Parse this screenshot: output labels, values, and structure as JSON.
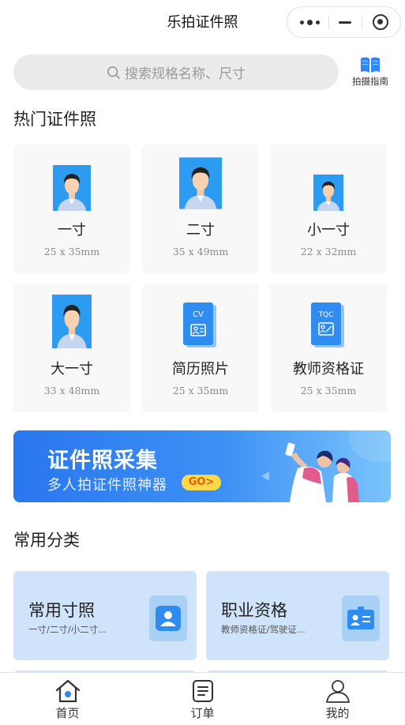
{
  "navbar": {
    "title": "乐拍证件照"
  },
  "search": {
    "placeholder": "搜索规格名称、尺寸",
    "guide_label": "拍摄指南"
  },
  "hot": {
    "title": "热门证件照",
    "cards": [
      {
        "name": "一寸",
        "size": "25 x 35mm",
        "icon": "portrait-icon"
      },
      {
        "name": "二寸",
        "size": "35 x 49mm",
        "icon": "portrait-icon"
      },
      {
        "name": "小一寸",
        "size": "22 x 32mm",
        "icon": "portrait-icon"
      },
      {
        "name": "大一寸",
        "size": "33 x 48mm",
        "icon": "portrait-icon"
      },
      {
        "name": "简历照片",
        "size": "25 x 35mm",
        "icon": "cv-document-icon",
        "badge": "CV"
      },
      {
        "name": "教师资格证",
        "size": "25 x 35mm",
        "icon": "teacher-certificate-icon",
        "badge": "TQC"
      }
    ]
  },
  "banner": {
    "title": "证件照采集",
    "subtitle": "多人拍证件照神器",
    "go_label": "GO>"
  },
  "categories": {
    "title": "常用分类",
    "items": [
      {
        "name": "常用寸照",
        "desc": "一寸/二寸/小二寸...",
        "icon": "portrait-square-icon"
      },
      {
        "name": "职业资格",
        "desc": "教师资格证/驾驶证...",
        "icon": "id-card-icon"
      }
    ]
  },
  "tabbar": {
    "items": [
      {
        "label": "首页",
        "icon": "home-icon",
        "active": true
      },
      {
        "label": "订单",
        "icon": "order-list-icon",
        "active": false
      },
      {
        "label": "我的",
        "icon": "user-icon",
        "active": false
      }
    ]
  },
  "colors": {
    "accent": "#2f86f6",
    "tile_bg": "#cfe4fb",
    "banner_go": "#ffd94a"
  }
}
